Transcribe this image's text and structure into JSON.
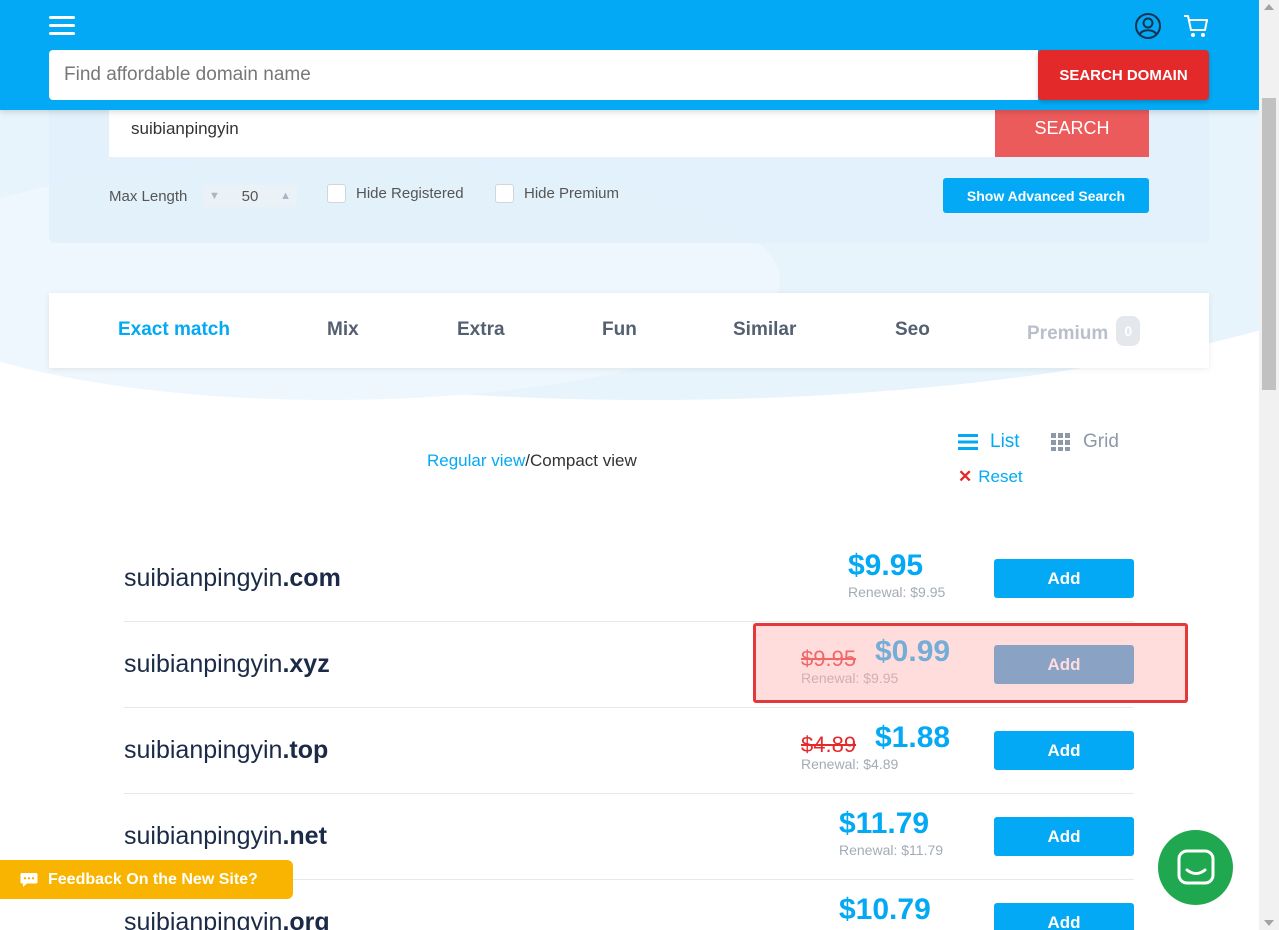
{
  "header": {
    "search_placeholder": "Find affordable domain name",
    "search_button": "SEARCH DOMAIN"
  },
  "search_panel": {
    "query": "suibianpingyin",
    "search_button": "SEARCH",
    "max_length_label": "Max Length",
    "max_length_value": "50",
    "hide_registered": "Hide Registered",
    "hide_premium": "Hide Premium",
    "advanced_button": "Show Advanced Search"
  },
  "tabs": [
    {
      "label": "Exact match",
      "active": true
    },
    {
      "label": "Mix"
    },
    {
      "label": "Extra"
    },
    {
      "label": "Fun"
    },
    {
      "label": "Similar"
    },
    {
      "label": "Seo"
    },
    {
      "label": "Premium",
      "count": "0",
      "disabled": true
    }
  ],
  "view": {
    "regular": "Regular view",
    "separator": "/",
    "compact": "Compact view",
    "list": "List",
    "grid": "Grid",
    "reset": "Reset"
  },
  "results": [
    {
      "name": "suibianpingyin",
      "tld": ".com",
      "old_price": "",
      "price": "$9.95",
      "renewal": "Renewal: $9.95",
      "add": "Add"
    },
    {
      "name": "suibianpingyin",
      "tld": ".xyz",
      "old_price": "$9.95",
      "price": "$0.99",
      "renewal": "Renewal: $9.95",
      "add": "Add"
    },
    {
      "name": "suibianpingyin",
      "tld": ".top",
      "old_price": "$4.89",
      "price": "$1.88",
      "renewal": "Renewal: $4.89",
      "add": "Add"
    },
    {
      "name": "suibianpingyin",
      "tld": ".net",
      "old_price": "",
      "price": "$11.79",
      "renewal": "Renewal: $11.79",
      "add": "Add"
    },
    {
      "name": "suibianpingyin",
      "tld": ".org",
      "old_price": "",
      "price": "$10.79",
      "renewal": "",
      "add": "Add"
    }
  ],
  "feedback": "Feedback On the New Site?",
  "colors": {
    "brand": "#03a9f4",
    "danger": "#e3292a",
    "feedback": "#f8b400",
    "chat": "#1fa84f"
  }
}
